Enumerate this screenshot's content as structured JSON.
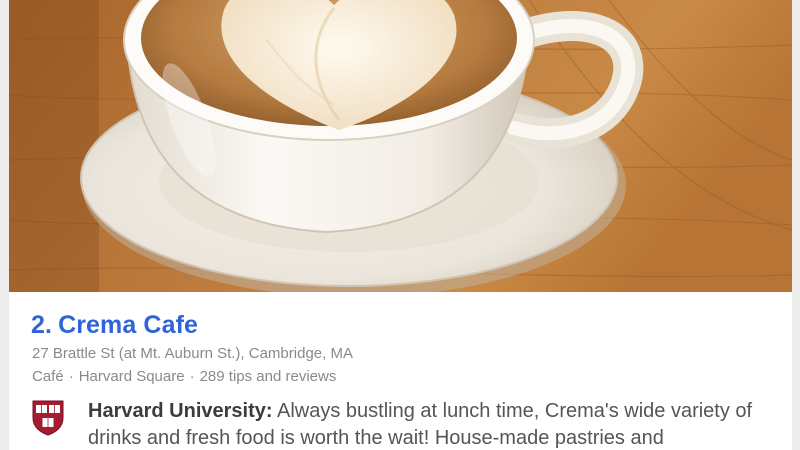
{
  "venue": {
    "rank": "2.",
    "name": "Crema Cafe",
    "address": "27 Brattle St (at Mt. Auburn St.), Cambridge, MA",
    "category": "Café",
    "separator": "·",
    "neighborhood": "Harvard Square",
    "tips_count": "289 tips and reviews"
  },
  "tip": {
    "author": "Harvard University:",
    "text": " Always bustling at lunch time, Crema's wide variety of drinks and fresh food is worth the wait! House-made pastries and",
    "avatar_icon": "harvard-shield-icon"
  },
  "photo": {
    "subject": "latte-photo"
  },
  "colors": {
    "title": "#2f63d9",
    "meta": "#8a8a8a",
    "tip_text": "#555555",
    "harvard_crimson": "#a51c30"
  }
}
